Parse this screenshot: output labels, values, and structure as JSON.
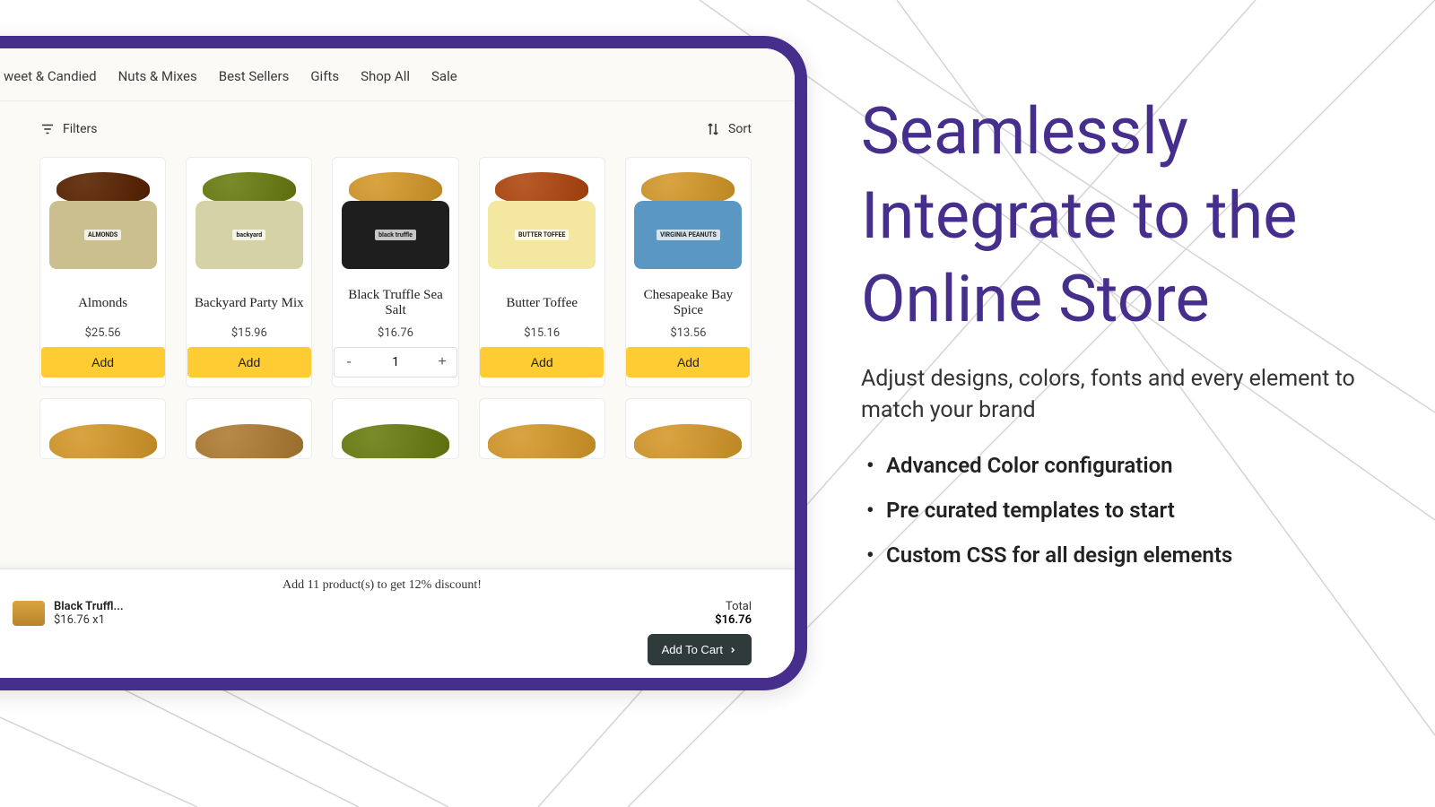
{
  "marketing": {
    "headline": "Seamlessly Integrate to the Online Store",
    "subhead": "Adjust designs, colors, fonts and every element  to match your brand",
    "bullets": [
      "Advanced Color configuration",
      "Pre curated templates to start",
      "Custom CSS for all design elements"
    ]
  },
  "nav": [
    "weet & Candied",
    "Nuts & Mixes",
    "Best Sellers",
    "Gifts",
    "Shop All",
    "Sale"
  ],
  "toolbar": {
    "filters": "Filters",
    "sort": "Sort"
  },
  "products": [
    {
      "name": "Almonds",
      "price": "$25.56",
      "action": "add",
      "add_label": "Add",
      "nuts_color": "#6b3a1a",
      "can_bg": "#cbbf8f",
      "label_text": "ALMONDS"
    },
    {
      "name": "Backyard Party Mix",
      "price": "$15.96",
      "action": "add",
      "add_label": "Add",
      "nuts_color": "#7a8b2a",
      "can_bg": "#d6d2a8",
      "label_text": "backyard"
    },
    {
      "name": "Black Truffle Sea Salt",
      "price": "$16.76",
      "action": "qty",
      "qty": "1",
      "nuts_color": "#d9a441",
      "can_bg": "#1e1e1e",
      "label_text": "black truffle"
    },
    {
      "name": "Butter Toffee",
      "price": "$15.16",
      "action": "add",
      "add_label": "Add",
      "nuts_color": "#b85a2a",
      "can_bg": "#f4e7a0",
      "label_text": "BUTTER TOFFEE"
    },
    {
      "name": "Chesapeake Bay Spice",
      "price": "$13.56",
      "action": "add",
      "add_label": "Add",
      "nuts_color": "#d9a441",
      "can_bg": "#5a97c2",
      "label_text": "VIRGINIA PEANUTS"
    }
  ],
  "row2_colors": [
    "#d9a441",
    "#b88a4a",
    "#7a8b2a",
    "#d9a441",
    "#d9a441"
  ],
  "cart": {
    "discount_msg": "Add 11 product(s) to get 12% discount!",
    "item_name": "Black Truffl...",
    "item_line": "$16.76 x1",
    "total_label": "Total",
    "total_value": "$16.76",
    "atc_label": "Add To Cart"
  },
  "qty_minus": "-",
  "qty_plus": "+"
}
